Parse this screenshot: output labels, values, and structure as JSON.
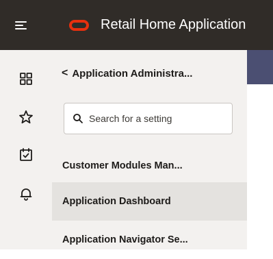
{
  "header": {
    "title": "Retail Home Application",
    "logo_color": "#e8300e",
    "menu_icon": "hamburger-menu-icon"
  },
  "iconbar": {
    "icons": [
      "grid-icon",
      "star-icon",
      "calendar-check-icon",
      "bell-icon"
    ]
  },
  "panel": {
    "back_label": "Application Administra...",
    "search_placeholder": "Search for a setting",
    "items": [
      {
        "label": "Customer Modules Man..."
      },
      {
        "label": "Application Dashboard",
        "selected": true
      },
      {
        "label": "Application Navigator Se..."
      }
    ]
  },
  "colors": {
    "topbar": "#302c28",
    "sidebar": "#f3f1ef",
    "selected_row": "#e4e2df",
    "accent_band": "#4b4f72"
  }
}
